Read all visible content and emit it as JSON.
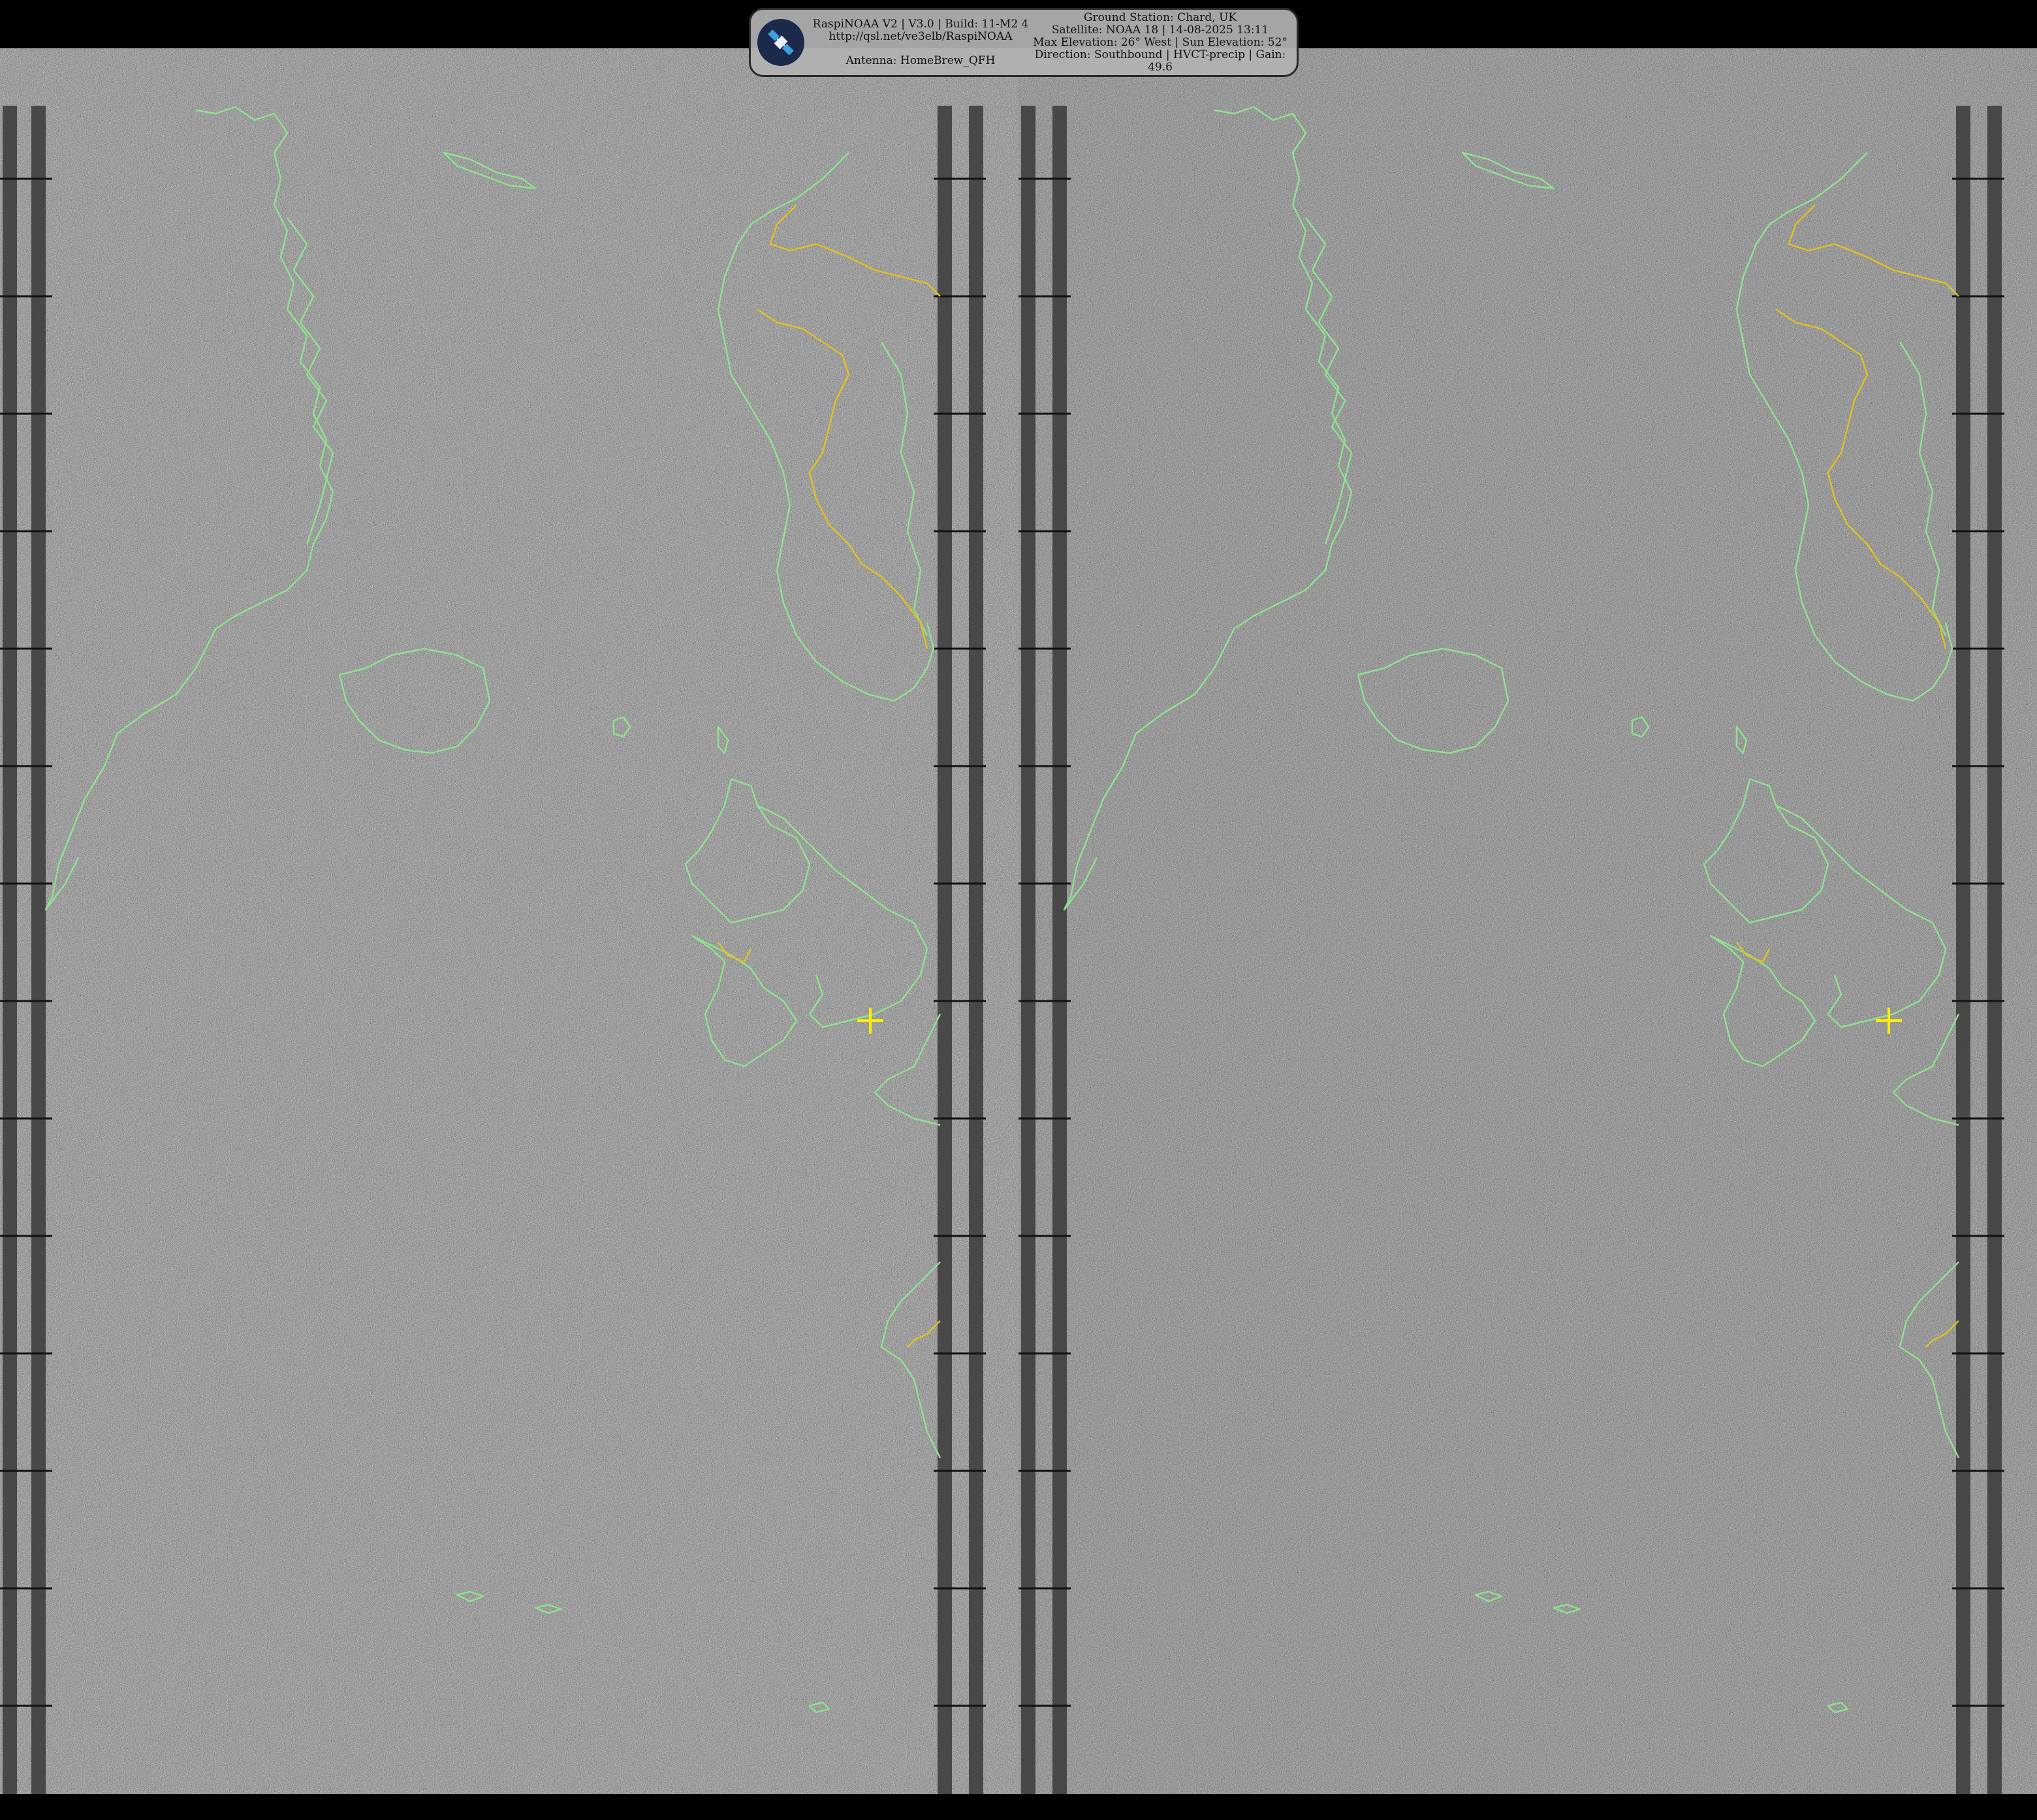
{
  "header": {
    "left_lines": [
      "RaspiNOAA V2 | V3.0 | Build: 11-M2 4",
      "http://qsl.net/ve3elb/RaspiNOAA",
      "Antenna: HomeBrew_QFH"
    ],
    "right_lines": [
      "Ground Station: Chard, UK",
      "Satellite: NOAA 18 | 14-08-2025 13:11",
      "Max Elevation: 26° West | Sun Elevation: 52°",
      "Direction: Southbound | HVCT-precip | Gain:",
      "49.6"
    ]
  },
  "image": {
    "channels": [
      "left",
      "right"
    ],
    "coastline_color": "#8fe08f",
    "border_color": "#e0c020",
    "station_marker_color": "#ffee00",
    "logo_icon": "satellite-icon"
  }
}
